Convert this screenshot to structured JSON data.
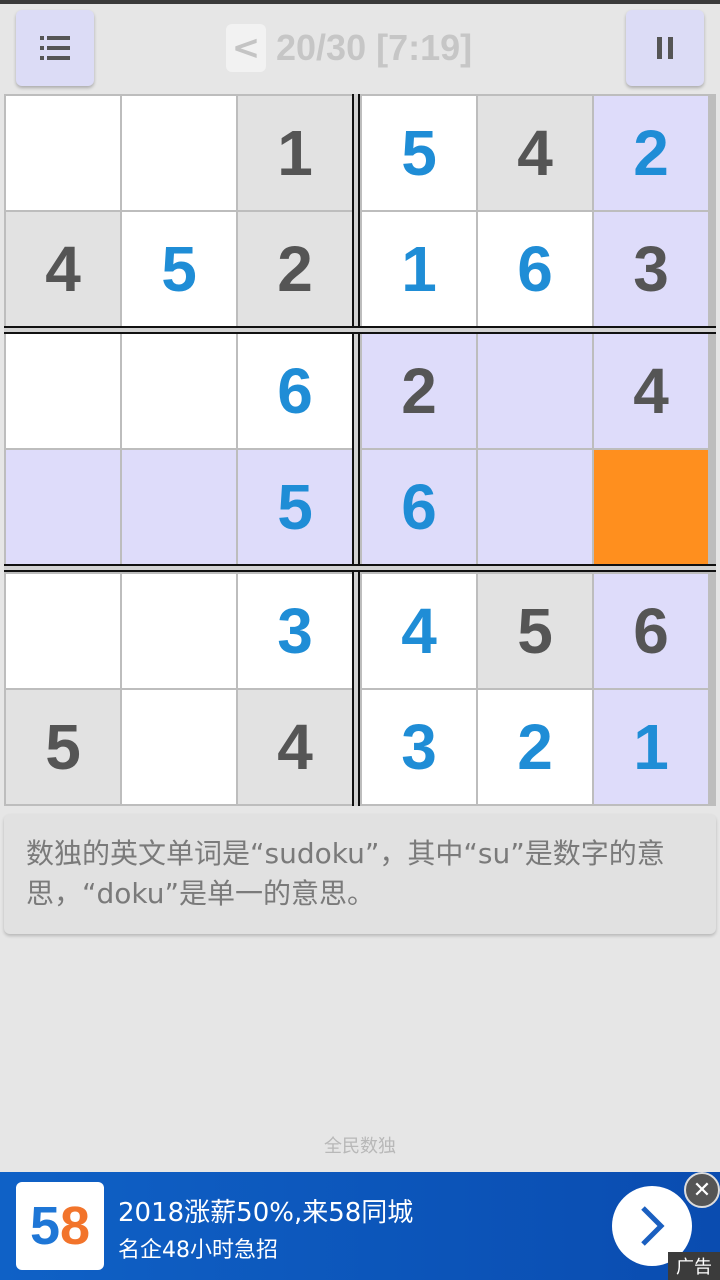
{
  "header": {
    "back_label": "<",
    "level_text": "20/30 [7:19]",
    "menu_icon": "list-icon",
    "pause_icon": "pause-icon"
  },
  "grid": {
    "rows": [
      [
        {
          "v": "",
          "bg": "white",
          "k": "user"
        },
        {
          "v": "",
          "bg": "white",
          "k": "user"
        },
        {
          "v": "1",
          "bg": "gray",
          "k": "given"
        },
        {
          "v": "5",
          "bg": "white",
          "k": "user"
        },
        {
          "v": "4",
          "bg": "gray",
          "k": "given"
        },
        {
          "v": "2",
          "bg": "lav",
          "k": "user"
        }
      ],
      [
        {
          "v": "4",
          "bg": "gray",
          "k": "given"
        },
        {
          "v": "5",
          "bg": "white",
          "k": "user"
        },
        {
          "v": "2",
          "bg": "gray",
          "k": "given"
        },
        {
          "v": "1",
          "bg": "white",
          "k": "user"
        },
        {
          "v": "6",
          "bg": "white",
          "k": "user"
        },
        {
          "v": "3",
          "bg": "lav",
          "k": "given"
        }
      ],
      [
        {
          "v": "",
          "bg": "white",
          "k": "user"
        },
        {
          "v": "",
          "bg": "white",
          "k": "user"
        },
        {
          "v": "6",
          "bg": "white",
          "k": "user"
        },
        {
          "v": "2",
          "bg": "lav",
          "k": "given"
        },
        {
          "v": "",
          "bg": "lav",
          "k": "user"
        },
        {
          "v": "4",
          "bg": "lav",
          "k": "given"
        }
      ],
      [
        {
          "v": "",
          "bg": "lav",
          "k": "user"
        },
        {
          "v": "",
          "bg": "lav",
          "k": "user"
        },
        {
          "v": "5",
          "bg": "lav",
          "k": "user"
        },
        {
          "v": "6",
          "bg": "lav",
          "k": "user"
        },
        {
          "v": "",
          "bg": "lav",
          "k": "user"
        },
        {
          "v": "",
          "bg": "orange",
          "k": "user"
        }
      ],
      [
        {
          "v": "",
          "bg": "white",
          "k": "user"
        },
        {
          "v": "",
          "bg": "white",
          "k": "user"
        },
        {
          "v": "3",
          "bg": "white",
          "k": "user"
        },
        {
          "v": "4",
          "bg": "white",
          "k": "user"
        },
        {
          "v": "5",
          "bg": "gray",
          "k": "given"
        },
        {
          "v": "6",
          "bg": "lav",
          "k": "given"
        }
      ],
      [
        {
          "v": "5",
          "bg": "gray",
          "k": "given"
        },
        {
          "v": "",
          "bg": "white",
          "k": "user"
        },
        {
          "v": "4",
          "bg": "gray",
          "k": "given"
        },
        {
          "v": "3",
          "bg": "white",
          "k": "user"
        },
        {
          "v": "2",
          "bg": "white",
          "k": "user"
        },
        {
          "v": "1",
          "bg": "lav",
          "k": "user"
        }
      ]
    ],
    "colors": {
      "white": "#ffffff",
      "gray": "#e2e2e2",
      "lavender": "#dedcfa",
      "selected": "#ff8f1e",
      "given_digit": "#555555",
      "user_digit": "#1f8dd6"
    }
  },
  "tip": {
    "text": "数独的英文单词是“sudoku”，其中“su”是数字的意思，“doku”是单一的意思。"
  },
  "footer": {
    "brand": "全民数独"
  },
  "ad": {
    "logo_5": "5",
    "logo_8": "8",
    "title": "2018涨薪50%,来58同城",
    "subtitle": "名企48小时急招",
    "close_label": "✕",
    "tag": "广告"
  }
}
